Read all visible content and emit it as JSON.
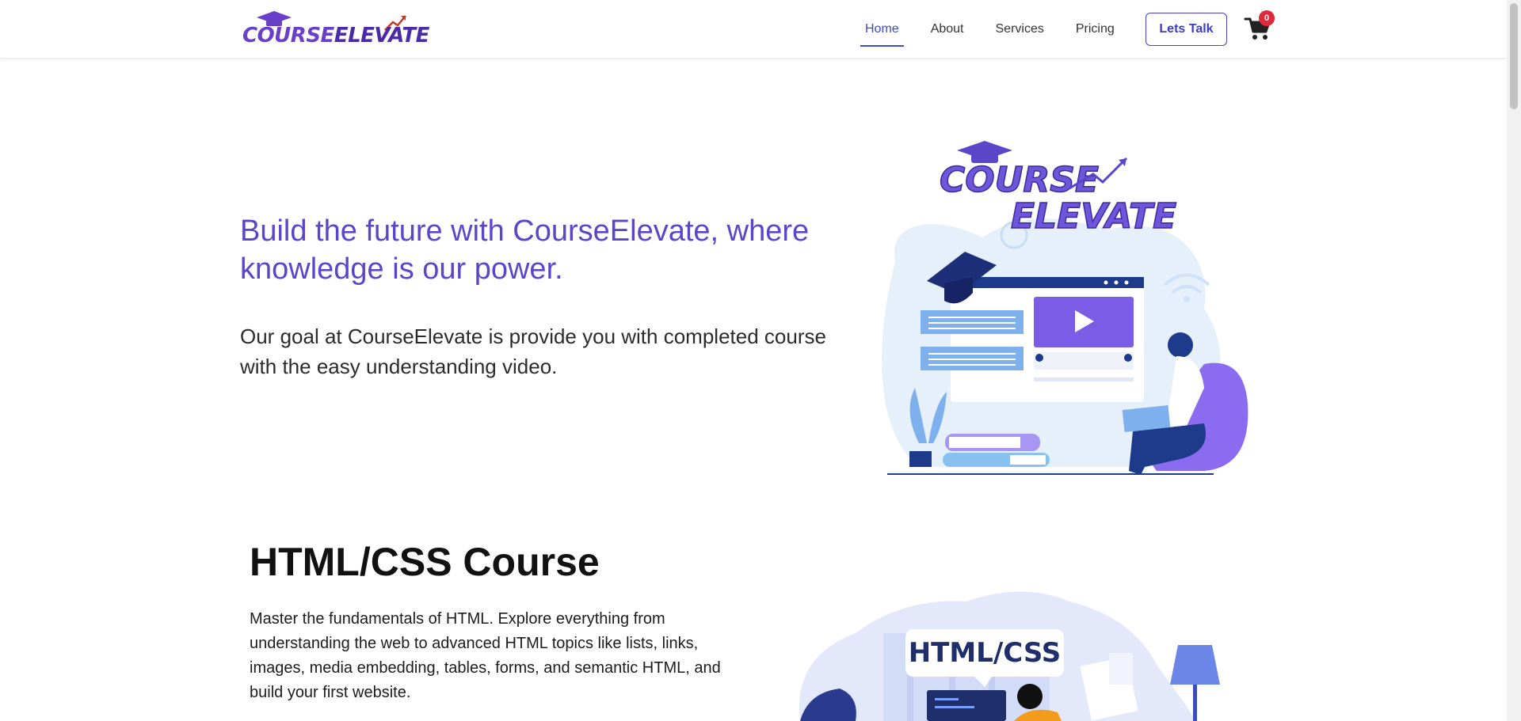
{
  "brand": {
    "name_part1": "COURSE",
    "name_part2": "ELEVATE",
    "primary": "#5b45c9",
    "accent": "#3e4cc9"
  },
  "nav": {
    "items": [
      {
        "label": "Home",
        "active": true
      },
      {
        "label": "About",
        "active": false
      },
      {
        "label": "Services",
        "active": false
      },
      {
        "label": "Pricing",
        "active": false
      }
    ],
    "cta_label": "Lets Talk",
    "cart_icon": "cart-icon",
    "cart_count": "0"
  },
  "hero": {
    "title": "Build the future with CourseElevate, where knowledge is our power.",
    "subtitle": "Our goal at CourseElevate is provide you with completed course with the easy understanding video.",
    "illustration": {
      "logo_line1": "COURSE",
      "logo_line2": "ELEVATE"
    }
  },
  "course": {
    "title": "HTML/CSS Course",
    "description": "Master the fundamentals of HTML. Explore everything from understanding the web to advanced HTML topics like lists, links, images, media embedding, tables, forms, and semantic HTML, and build your first website.",
    "illustration_label": "HTML/CSS"
  }
}
